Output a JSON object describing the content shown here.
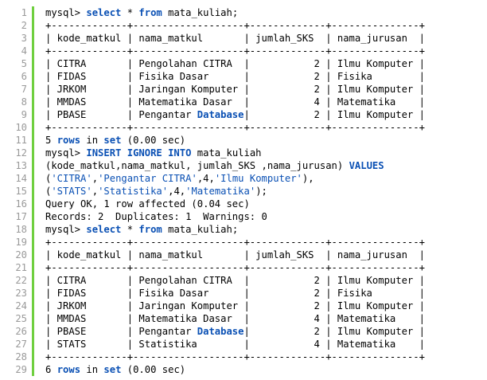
{
  "colors": {
    "gutter_bar": "#6fcf3f",
    "line_number": "#9a9a9a",
    "keyword": "#0a50b4",
    "string": "#0a50b4",
    "text": "#000000",
    "background": "#ffffff"
  },
  "lines": [
    {
      "n": "1",
      "segs": [
        {
          "t": "mysql> ",
          "c": "plain"
        },
        {
          "t": "select",
          "c": "kw"
        },
        {
          "t": " * ",
          "c": "plain"
        },
        {
          "t": "from",
          "c": "kw"
        },
        {
          "t": " mata_kuliah;",
          "c": "plain"
        }
      ]
    },
    {
      "n": "2",
      "segs": [
        {
          "t": "+-------------+-------------------+-------------+---------------+",
          "c": "plain"
        }
      ]
    },
    {
      "n": "3",
      "segs": [
        {
          "t": "| kode_matkul | nama_matkul       | jumlah_SKS  | nama_jurusan  |",
          "c": "plain"
        }
      ]
    },
    {
      "n": "4",
      "segs": [
        {
          "t": "+-------------+-------------------+-------------+---------------+",
          "c": "plain"
        }
      ]
    },
    {
      "n": "5",
      "segs": [
        {
          "t": "| CITRA       | Pengolahan CITRA  |           2 | Ilmu Komputer |",
          "c": "plain"
        }
      ]
    },
    {
      "n": "6",
      "segs": [
        {
          "t": "| FIDAS       | Fisika Dasar      |           2 | Fisika        |",
          "c": "plain"
        }
      ]
    },
    {
      "n": "7",
      "segs": [
        {
          "t": "| JRKOM       | Jaringan Komputer |           2 | Ilmu Komputer |",
          "c": "plain"
        }
      ]
    },
    {
      "n": "8",
      "segs": [
        {
          "t": "| MMDAS       | Matematika Dasar  |           4 | Matematika    |",
          "c": "plain"
        }
      ]
    },
    {
      "n": "9",
      "segs": [
        {
          "t": "| PBASE       | Pengantar ",
          "c": "plain"
        },
        {
          "t": "Database",
          "c": "link"
        },
        {
          "t": "|           2 | Ilmu Komputer |",
          "c": "plain"
        }
      ]
    },
    {
      "n": "10",
      "segs": [
        {
          "t": "+-------------+-------------------+-------------+---------------+",
          "c": "plain"
        }
      ]
    },
    {
      "n": "11",
      "segs": [
        {
          "t": "5 ",
          "c": "plain"
        },
        {
          "t": "rows",
          "c": "kw"
        },
        {
          "t": " in ",
          "c": "plain"
        },
        {
          "t": "set",
          "c": "kw"
        },
        {
          "t": " (0.00 sec)",
          "c": "plain"
        }
      ]
    },
    {
      "n": "12",
      "segs": [
        {
          "t": "mysql> ",
          "c": "plain"
        },
        {
          "t": "INSERT IGNORE INTO",
          "c": "kw"
        },
        {
          "t": " mata_kuliah",
          "c": "plain"
        }
      ]
    },
    {
      "n": "13",
      "segs": [
        {
          "t": "(kode_matkul,nama_matkul, jumlah_SKS ,nama_jurusan) ",
          "c": "plain"
        },
        {
          "t": "VALUES",
          "c": "kw"
        }
      ]
    },
    {
      "n": "14",
      "segs": [
        {
          "t": "(",
          "c": "plain"
        },
        {
          "t": "'CITRA'",
          "c": "str"
        },
        {
          "t": ",",
          "c": "plain"
        },
        {
          "t": "'Pengantar CITRA'",
          "c": "str"
        },
        {
          "t": ",4,",
          "c": "plain"
        },
        {
          "t": "'Ilmu Komputer'",
          "c": "str"
        },
        {
          "t": "),",
          "c": "plain"
        }
      ]
    },
    {
      "n": "15",
      "segs": [
        {
          "t": "(",
          "c": "plain"
        },
        {
          "t": "'STATS'",
          "c": "str"
        },
        {
          "t": ",",
          "c": "plain"
        },
        {
          "t": "'Statistika'",
          "c": "str"
        },
        {
          "t": ",4,",
          "c": "plain"
        },
        {
          "t": "'Matematika'",
          "c": "str"
        },
        {
          "t": ");",
          "c": "plain"
        }
      ]
    },
    {
      "n": "16",
      "segs": [
        {
          "t": "Query OK, 1 row affected (0.04 sec)",
          "c": "plain"
        }
      ]
    },
    {
      "n": "17",
      "segs": [
        {
          "t": "Records: 2  Duplicates: 1  Warnings: 0",
          "c": "plain"
        }
      ]
    },
    {
      "n": "18",
      "segs": [
        {
          "t": "mysql> ",
          "c": "plain"
        },
        {
          "t": "select",
          "c": "kw"
        },
        {
          "t": " * ",
          "c": "plain"
        },
        {
          "t": "from",
          "c": "kw"
        },
        {
          "t": " mata_kuliah;",
          "c": "plain"
        }
      ]
    },
    {
      "n": "19",
      "segs": [
        {
          "t": "+-------------+-------------------+-------------+---------------+",
          "c": "plain"
        }
      ]
    },
    {
      "n": "20",
      "segs": [
        {
          "t": "| kode_matkul | nama_matkul       | jumlah_SKS  | nama_jurusan  |",
          "c": "plain"
        }
      ]
    },
    {
      "n": "21",
      "segs": [
        {
          "t": "+-------------+-------------------+-------------+---------------+",
          "c": "plain"
        }
      ]
    },
    {
      "n": "22",
      "segs": [
        {
          "t": "| CITRA       | Pengolahan CITRA  |           2 | Ilmu Komputer |",
          "c": "plain"
        }
      ]
    },
    {
      "n": "23",
      "segs": [
        {
          "t": "| FIDAS       | Fisika Dasar      |           2 | Fisika        |",
          "c": "plain"
        }
      ]
    },
    {
      "n": "24",
      "segs": [
        {
          "t": "| JRKOM       | Jaringan Komputer |           2 | Ilmu Komputer |",
          "c": "plain"
        }
      ]
    },
    {
      "n": "25",
      "segs": [
        {
          "t": "| MMDAS       | Matematika Dasar  |           4 | Matematika    |",
          "c": "plain"
        }
      ]
    },
    {
      "n": "26",
      "segs": [
        {
          "t": "| PBASE       | Pengantar ",
          "c": "plain"
        },
        {
          "t": "Database",
          "c": "link"
        },
        {
          "t": "|           2 | Ilmu Komputer |",
          "c": "plain"
        }
      ]
    },
    {
      "n": "27",
      "segs": [
        {
          "t": "| STATS       | Statistika        |           4 | Matematika    |",
          "c": "plain"
        }
      ]
    },
    {
      "n": "28",
      "segs": [
        {
          "t": "+-------------+-------------------+-------------+---------------+",
          "c": "plain"
        }
      ]
    },
    {
      "n": "29",
      "segs": [
        {
          "t": "6 ",
          "c": "plain"
        },
        {
          "t": "rows",
          "c": "kw"
        },
        {
          "t": " in ",
          "c": "plain"
        },
        {
          "t": "set",
          "c": "kw"
        },
        {
          "t": " (0.00 sec)",
          "c": "plain"
        }
      ]
    }
  ]
}
